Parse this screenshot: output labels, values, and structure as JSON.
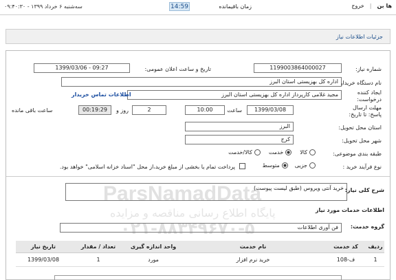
{
  "topbar": {
    "user_link": "ها بن",
    "exit_link": "خروج",
    "time_label": "زمان باقیمانده",
    "time_value": "14:59",
    "date_text": "سه‌شنبه ۶ خرداد ۱۳۹۹ - ۰۹:۴۰:۳۰"
  },
  "panel": {
    "title": "جزئیات اطلاعات نیاز"
  },
  "form": {
    "need_number_label": "شماره نیاز:",
    "need_number": "1199003864000027",
    "announce_label": "تاریخ و ساعت اعلان عمومی:",
    "announce_value": "1399/03/06 - 09:27",
    "buyer_label": "نام دستگاه خریدار:",
    "buyer_value": "اداره کل بهزیستی استان البرز",
    "creator_label": "ایجاد کننده درخواست:",
    "creator_value": "مجید غلامی کارپرداز اداره کل بهزیستی استان البرز",
    "contact_link": "اطلاعات تماس خریدار",
    "deadline_label": "مهلت ارسال پاسخ: تا تاریخ:",
    "deadline_date": "1399/03/08",
    "hour_label": "ساعت",
    "deadline_hour": "10:00",
    "days_value": "2",
    "days_label": "روز و",
    "remaining_time": "00:19:29",
    "remaining_label": "ساعت باقی مانده",
    "province_label": "استان محل تحویل:",
    "province_value": "البرز",
    "city_label": "شهر محل تحویل:",
    "city_value": "کرج",
    "category_label": "طبقه بندی موضوعی:",
    "category_options": [
      "کالا",
      "خدمت",
      "کالا/خدمت"
    ],
    "process_label": "نوع فرآیند خرید :",
    "process_options": [
      "جزیی",
      "متوسط"
    ],
    "payment_note": "پرداخت تمام یا بخشی از مبلغ خرید،از محل \"اسناد خزانه اسلامی\" خواهد بود."
  },
  "summary": {
    "label": "شرح کلی نیاز:",
    "text": "خرید آنتی ویروس (طبق لیست پیوست)"
  },
  "services": {
    "heading": "اطلاعات خدمات مورد نیاز",
    "group_label": "گروه خدمت:",
    "group_value": "فن آوری اطلاعات",
    "columns": [
      "ردیف",
      "کد خدمت",
      "نام خدمت",
      "واحد اندازه گیری",
      "تعداد / مقدار",
      "تاریخ نیاز"
    ],
    "rows": [
      [
        "1",
        "ف-108",
        "خرید نرم افزار",
        "مورد",
        "1",
        "1399/03/08"
      ]
    ]
  },
  "watermark": {
    "brand": "ParsNamadData",
    "line1": "پایگاه اطلاع رسانی مناقصه و مزایده",
    "phone": "۰۲۱-۸۸۳۴۹۶۷۰-۵"
  }
}
